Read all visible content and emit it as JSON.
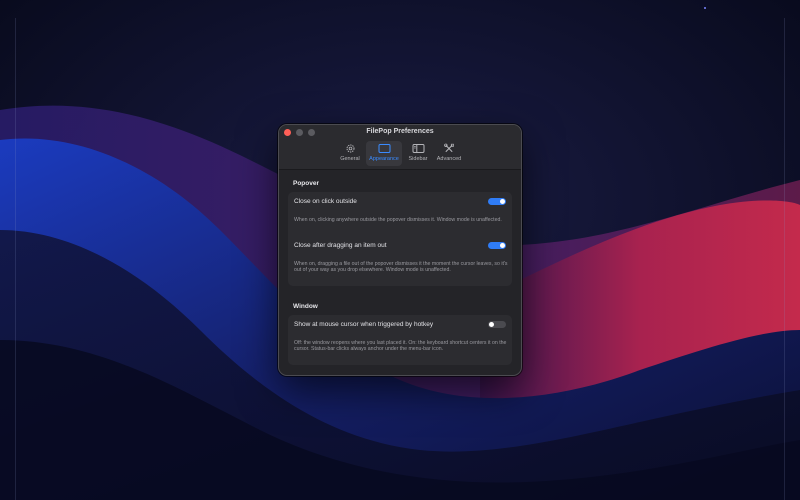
{
  "window": {
    "title": "FilePop Preferences",
    "tabs": [
      {
        "label": "General",
        "icon": "gear-icon",
        "active": false
      },
      {
        "label": "Appearance",
        "icon": "window-icon",
        "active": true
      },
      {
        "label": "Sidebar",
        "icon": "sidebar-icon",
        "active": false
      },
      {
        "label": "Advanced",
        "icon": "tools-icon",
        "active": false
      }
    ]
  },
  "popover": {
    "title": "Popover",
    "close_outside": {
      "label": "Close on click outside",
      "enabled": true,
      "description": "When on, clicking anywhere outside the popover dismisses it. Window mode is unaffected."
    },
    "close_drag": {
      "label": "Close after dragging an item out",
      "enabled": true,
      "description": "When on, dragging a file out of the popover dismisses it the moment the cursor leaves, so it's out of your way as you drop elsewhere. Window mode is unaffected."
    }
  },
  "window_section": {
    "title": "Window",
    "show_at_cursor": {
      "label": "Show at mouse cursor when triggered by hotkey",
      "enabled": false,
      "description": "Off: the window reopens where you last placed it. On: the keyboard shortcut centers it on the cursor. Status-bar clicks always anchor under the menu-bar icon."
    }
  },
  "colors": {
    "accent": "#2f7cf6",
    "close_button": "#ff5f57",
    "window_bg": "#242428"
  }
}
